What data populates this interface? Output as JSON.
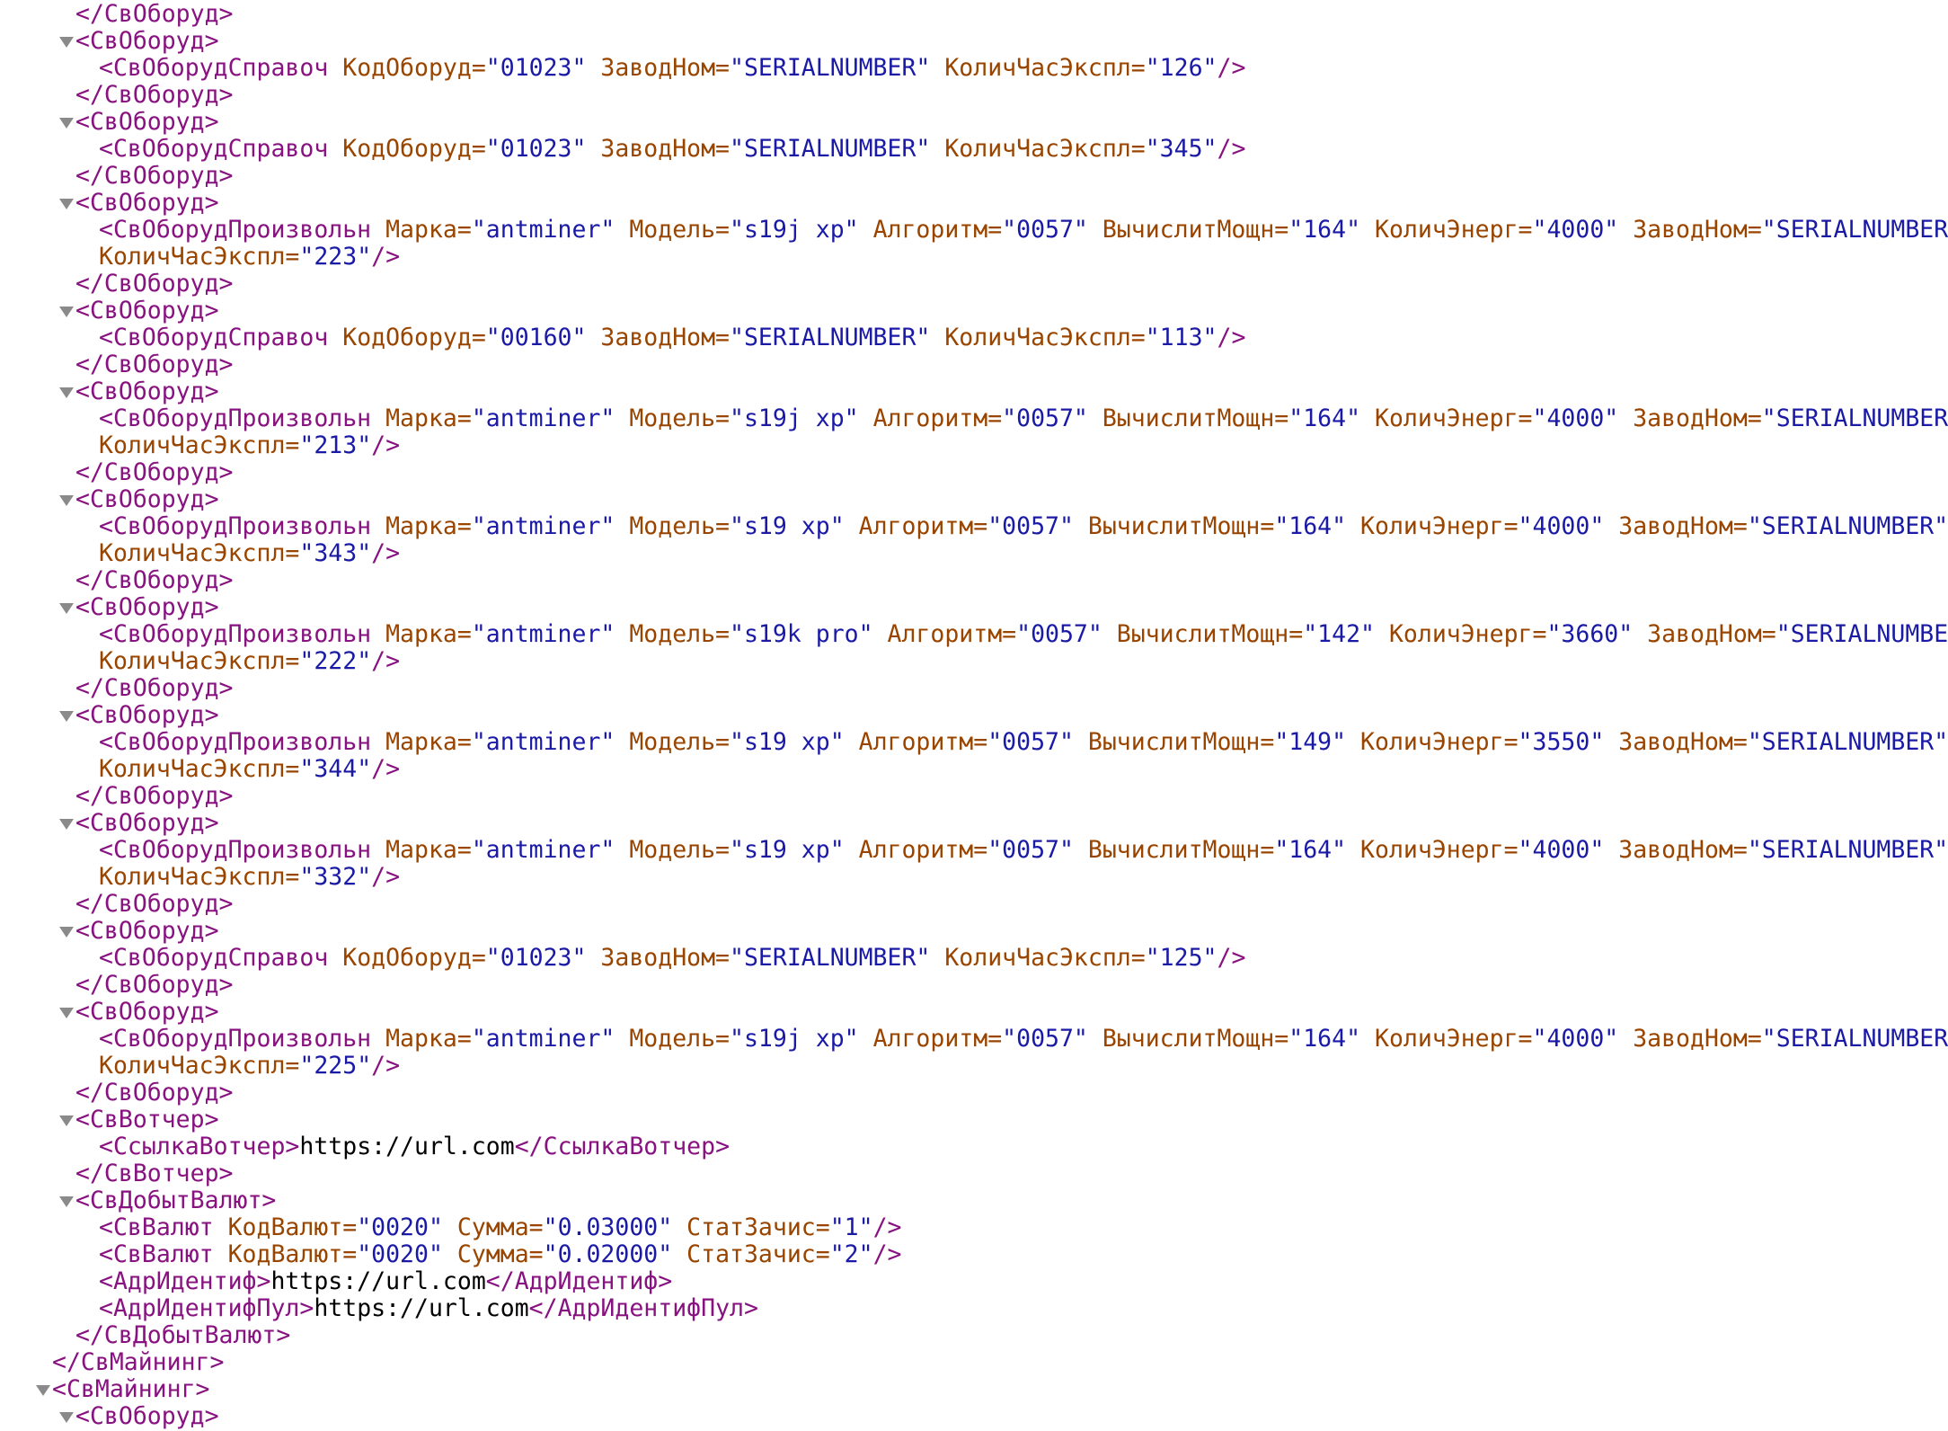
{
  "colors": {
    "tag": "#881280",
    "attribute_name": "#994500",
    "attribute_value": "#1a1aa6",
    "text": "#000000",
    "toggle": "#8a8a8a"
  },
  "lines": [
    {
      "indent": 1,
      "toggle": false,
      "segments": [
        {
          "t": "tag",
          "v": "</СвОборуд>"
        }
      ]
    },
    {
      "indent": 1,
      "toggle": true,
      "segments": [
        {
          "t": "tag",
          "v": "<СвОборуд>"
        }
      ]
    },
    {
      "indent": 2,
      "toggle": false,
      "segments": [
        {
          "t": "tag",
          "v": "<СвОборудСправоч "
        },
        {
          "t": "attr-name",
          "v": "КодОборуд="
        },
        {
          "t": "attr-value",
          "v": "\"01023\""
        },
        {
          "t": "attr-name",
          "v": " ЗаводНом="
        },
        {
          "t": "attr-value",
          "v": "\"SERIALNUMBER\""
        },
        {
          "t": "attr-name",
          "v": " КоличЧасЭкспл="
        },
        {
          "t": "attr-value",
          "v": "\"126\""
        },
        {
          "t": "tag",
          "v": "/>"
        }
      ]
    },
    {
      "indent": 1,
      "toggle": false,
      "segments": [
        {
          "t": "tag",
          "v": "</СвОборуд>"
        }
      ]
    },
    {
      "indent": 1,
      "toggle": true,
      "segments": [
        {
          "t": "tag",
          "v": "<СвОборуд>"
        }
      ]
    },
    {
      "indent": 2,
      "toggle": false,
      "segments": [
        {
          "t": "tag",
          "v": "<СвОборудСправоч "
        },
        {
          "t": "attr-name",
          "v": "КодОборуд="
        },
        {
          "t": "attr-value",
          "v": "\"01023\""
        },
        {
          "t": "attr-name",
          "v": " ЗаводНом="
        },
        {
          "t": "attr-value",
          "v": "\"SERIALNUMBER\""
        },
        {
          "t": "attr-name",
          "v": " КоличЧасЭкспл="
        },
        {
          "t": "attr-value",
          "v": "\"345\""
        },
        {
          "t": "tag",
          "v": "/>"
        }
      ]
    },
    {
      "indent": 1,
      "toggle": false,
      "segments": [
        {
          "t": "tag",
          "v": "</СвОборуд>"
        }
      ]
    },
    {
      "indent": 1,
      "toggle": true,
      "segments": [
        {
          "t": "tag",
          "v": "<СвОборуд>"
        }
      ]
    },
    {
      "indent": 2,
      "toggle": false,
      "segments": [
        {
          "t": "tag",
          "v": "<СвОборудПроизвольн "
        },
        {
          "t": "attr-name",
          "v": "Марка="
        },
        {
          "t": "attr-value",
          "v": "\"antminer\""
        },
        {
          "t": "attr-name",
          "v": " Модель="
        },
        {
          "t": "attr-value",
          "v": "\"s19j xp\""
        },
        {
          "t": "attr-name",
          "v": " Алгоритм="
        },
        {
          "t": "attr-value",
          "v": "\"0057\""
        },
        {
          "t": "attr-name",
          "v": " ВычислитМощн="
        },
        {
          "t": "attr-value",
          "v": "\"164\""
        },
        {
          "t": "attr-name",
          "v": " КоличЭнерг="
        },
        {
          "t": "attr-value",
          "v": "\"4000\""
        },
        {
          "t": "attr-name",
          "v": " ЗаводНом="
        },
        {
          "t": "attr-value",
          "v": "\"SERIALNUMBER\""
        }
      ]
    },
    {
      "indent": 2,
      "toggle": false,
      "segments": [
        {
          "t": "attr-name",
          "v": "КоличЧасЭкспл="
        },
        {
          "t": "attr-value",
          "v": "\"223\""
        },
        {
          "t": "tag",
          "v": "/>"
        }
      ]
    },
    {
      "indent": 1,
      "toggle": false,
      "segments": [
        {
          "t": "tag",
          "v": "</СвОборуд>"
        }
      ]
    },
    {
      "indent": 1,
      "toggle": true,
      "segments": [
        {
          "t": "tag",
          "v": "<СвОборуд>"
        }
      ]
    },
    {
      "indent": 2,
      "toggle": false,
      "segments": [
        {
          "t": "tag",
          "v": "<СвОборудСправоч "
        },
        {
          "t": "attr-name",
          "v": "КодОборуд="
        },
        {
          "t": "attr-value",
          "v": "\"00160\""
        },
        {
          "t": "attr-name",
          "v": " ЗаводНом="
        },
        {
          "t": "attr-value",
          "v": "\"SERIALNUMBER\""
        },
        {
          "t": "attr-name",
          "v": " КоличЧасЭкспл="
        },
        {
          "t": "attr-value",
          "v": "\"113\""
        },
        {
          "t": "tag",
          "v": "/>"
        }
      ]
    },
    {
      "indent": 1,
      "toggle": false,
      "segments": [
        {
          "t": "tag",
          "v": "</СвОборуд>"
        }
      ]
    },
    {
      "indent": 1,
      "toggle": true,
      "segments": [
        {
          "t": "tag",
          "v": "<СвОборуд>"
        }
      ]
    },
    {
      "indent": 2,
      "toggle": false,
      "segments": [
        {
          "t": "tag",
          "v": "<СвОборудПроизвольн "
        },
        {
          "t": "attr-name",
          "v": "Марка="
        },
        {
          "t": "attr-value",
          "v": "\"antminer\""
        },
        {
          "t": "attr-name",
          "v": " Модель="
        },
        {
          "t": "attr-value",
          "v": "\"s19j xp\""
        },
        {
          "t": "attr-name",
          "v": " Алгоритм="
        },
        {
          "t": "attr-value",
          "v": "\"0057\""
        },
        {
          "t": "attr-name",
          "v": " ВычислитМощн="
        },
        {
          "t": "attr-value",
          "v": "\"164\""
        },
        {
          "t": "attr-name",
          "v": " КоличЭнерг="
        },
        {
          "t": "attr-value",
          "v": "\"4000\""
        },
        {
          "t": "attr-name",
          "v": " ЗаводНом="
        },
        {
          "t": "attr-value",
          "v": "\"SERIALNUMBER\""
        }
      ]
    },
    {
      "indent": 2,
      "toggle": false,
      "segments": [
        {
          "t": "attr-name",
          "v": "КоличЧасЭкспл="
        },
        {
          "t": "attr-value",
          "v": "\"213\""
        },
        {
          "t": "tag",
          "v": "/>"
        }
      ]
    },
    {
      "indent": 1,
      "toggle": false,
      "segments": [
        {
          "t": "tag",
          "v": "</СвОборуд>"
        }
      ]
    },
    {
      "indent": 1,
      "toggle": true,
      "segments": [
        {
          "t": "tag",
          "v": "<СвОборуд>"
        }
      ]
    },
    {
      "indent": 2,
      "toggle": false,
      "segments": [
        {
          "t": "tag",
          "v": "<СвОборудПроизвольн "
        },
        {
          "t": "attr-name",
          "v": "Марка="
        },
        {
          "t": "attr-value",
          "v": "\"antminer\""
        },
        {
          "t": "attr-name",
          "v": " Модель="
        },
        {
          "t": "attr-value",
          "v": "\"s19 xp\""
        },
        {
          "t": "attr-name",
          "v": " Алгоритм="
        },
        {
          "t": "attr-value",
          "v": "\"0057\""
        },
        {
          "t": "attr-name",
          "v": " ВычислитМощн="
        },
        {
          "t": "attr-value",
          "v": "\"164\""
        },
        {
          "t": "attr-name",
          "v": " КоличЭнерг="
        },
        {
          "t": "attr-value",
          "v": "\"4000\""
        },
        {
          "t": "attr-name",
          "v": " ЗаводНом="
        },
        {
          "t": "attr-value",
          "v": "\"SERIALNUMBER\""
        }
      ]
    },
    {
      "indent": 2,
      "toggle": false,
      "segments": [
        {
          "t": "attr-name",
          "v": "КоличЧасЭкспл="
        },
        {
          "t": "attr-value",
          "v": "\"343\""
        },
        {
          "t": "tag",
          "v": "/>"
        }
      ]
    },
    {
      "indent": 1,
      "toggle": false,
      "segments": [
        {
          "t": "tag",
          "v": "</СвОборуд>"
        }
      ]
    },
    {
      "indent": 1,
      "toggle": true,
      "segments": [
        {
          "t": "tag",
          "v": "<СвОборуд>"
        }
      ]
    },
    {
      "indent": 2,
      "toggle": false,
      "segments": [
        {
          "t": "tag",
          "v": "<СвОборудПроизвольн "
        },
        {
          "t": "attr-name",
          "v": "Марка="
        },
        {
          "t": "attr-value",
          "v": "\"antminer\""
        },
        {
          "t": "attr-name",
          "v": " Модель="
        },
        {
          "t": "attr-value",
          "v": "\"s19k pro\""
        },
        {
          "t": "attr-name",
          "v": " Алгоритм="
        },
        {
          "t": "attr-value",
          "v": "\"0057\""
        },
        {
          "t": "attr-name",
          "v": " ВычислитМощн="
        },
        {
          "t": "attr-value",
          "v": "\"142\""
        },
        {
          "t": "attr-name",
          "v": " КоличЭнерг="
        },
        {
          "t": "attr-value",
          "v": "\"3660\""
        },
        {
          "t": "attr-name",
          "v": " ЗаводНом="
        },
        {
          "t": "attr-value",
          "v": "\"SERIALNUMBER\""
        }
      ]
    },
    {
      "indent": 2,
      "toggle": false,
      "segments": [
        {
          "t": "attr-name",
          "v": "КоличЧасЭкспл="
        },
        {
          "t": "attr-value",
          "v": "\"222\""
        },
        {
          "t": "tag",
          "v": "/>"
        }
      ]
    },
    {
      "indent": 1,
      "toggle": false,
      "segments": [
        {
          "t": "tag",
          "v": "</СвОборуд>"
        }
      ]
    },
    {
      "indent": 1,
      "toggle": true,
      "segments": [
        {
          "t": "tag",
          "v": "<СвОборуд>"
        }
      ]
    },
    {
      "indent": 2,
      "toggle": false,
      "segments": [
        {
          "t": "tag",
          "v": "<СвОборудПроизвольн "
        },
        {
          "t": "attr-name",
          "v": "Марка="
        },
        {
          "t": "attr-value",
          "v": "\"antminer\""
        },
        {
          "t": "attr-name",
          "v": " Модель="
        },
        {
          "t": "attr-value",
          "v": "\"s19 xp\""
        },
        {
          "t": "attr-name",
          "v": " Алгоритм="
        },
        {
          "t": "attr-value",
          "v": "\"0057\""
        },
        {
          "t": "attr-name",
          "v": " ВычислитМощн="
        },
        {
          "t": "attr-value",
          "v": "\"149\""
        },
        {
          "t": "attr-name",
          "v": " КоличЭнерг="
        },
        {
          "t": "attr-value",
          "v": "\"3550\""
        },
        {
          "t": "attr-name",
          "v": " ЗаводНом="
        },
        {
          "t": "attr-value",
          "v": "\"SERIALNUMBER\""
        }
      ]
    },
    {
      "indent": 2,
      "toggle": false,
      "segments": [
        {
          "t": "attr-name",
          "v": "КоличЧасЭкспл="
        },
        {
          "t": "attr-value",
          "v": "\"344\""
        },
        {
          "t": "tag",
          "v": "/>"
        }
      ]
    },
    {
      "indent": 1,
      "toggle": false,
      "segments": [
        {
          "t": "tag",
          "v": "</СвОборуд>"
        }
      ]
    },
    {
      "indent": 1,
      "toggle": true,
      "segments": [
        {
          "t": "tag",
          "v": "<СвОборуд>"
        }
      ]
    },
    {
      "indent": 2,
      "toggle": false,
      "segments": [
        {
          "t": "tag",
          "v": "<СвОборудПроизвольн "
        },
        {
          "t": "attr-name",
          "v": "Марка="
        },
        {
          "t": "attr-value",
          "v": "\"antminer\""
        },
        {
          "t": "attr-name",
          "v": " Модель="
        },
        {
          "t": "attr-value",
          "v": "\"s19 xp\""
        },
        {
          "t": "attr-name",
          "v": " Алгоритм="
        },
        {
          "t": "attr-value",
          "v": "\"0057\""
        },
        {
          "t": "attr-name",
          "v": " ВычислитМощн="
        },
        {
          "t": "attr-value",
          "v": "\"164\""
        },
        {
          "t": "attr-name",
          "v": " КоличЭнерг="
        },
        {
          "t": "attr-value",
          "v": "\"4000\""
        },
        {
          "t": "attr-name",
          "v": " ЗаводНом="
        },
        {
          "t": "attr-value",
          "v": "\"SERIALNUMBER\""
        }
      ]
    },
    {
      "indent": 2,
      "toggle": false,
      "segments": [
        {
          "t": "attr-name",
          "v": "КоличЧасЭкспл="
        },
        {
          "t": "attr-value",
          "v": "\"332\""
        },
        {
          "t": "tag",
          "v": "/>"
        }
      ]
    },
    {
      "indent": 1,
      "toggle": false,
      "segments": [
        {
          "t": "tag",
          "v": "</СвОборуд>"
        }
      ]
    },
    {
      "indent": 1,
      "toggle": true,
      "segments": [
        {
          "t": "tag",
          "v": "<СвОборуд>"
        }
      ]
    },
    {
      "indent": 2,
      "toggle": false,
      "segments": [
        {
          "t": "tag",
          "v": "<СвОборудСправоч "
        },
        {
          "t": "attr-name",
          "v": "КодОборуд="
        },
        {
          "t": "attr-value",
          "v": "\"01023\""
        },
        {
          "t": "attr-name",
          "v": " ЗаводНом="
        },
        {
          "t": "attr-value",
          "v": "\"SERIALNUMBER\""
        },
        {
          "t": "attr-name",
          "v": " КоличЧасЭкспл="
        },
        {
          "t": "attr-value",
          "v": "\"125\""
        },
        {
          "t": "tag",
          "v": "/>"
        }
      ]
    },
    {
      "indent": 1,
      "toggle": false,
      "segments": [
        {
          "t": "tag",
          "v": "</СвОборуд>"
        }
      ]
    },
    {
      "indent": 1,
      "toggle": true,
      "segments": [
        {
          "t": "tag",
          "v": "<СвОборуд>"
        }
      ]
    },
    {
      "indent": 2,
      "toggle": false,
      "segments": [
        {
          "t": "tag",
          "v": "<СвОборудПроизвольн "
        },
        {
          "t": "attr-name",
          "v": "Марка="
        },
        {
          "t": "attr-value",
          "v": "\"antminer\""
        },
        {
          "t": "attr-name",
          "v": " Модель="
        },
        {
          "t": "attr-value",
          "v": "\"s19j xp\""
        },
        {
          "t": "attr-name",
          "v": " Алгоритм="
        },
        {
          "t": "attr-value",
          "v": "\"0057\""
        },
        {
          "t": "attr-name",
          "v": " ВычислитМощн="
        },
        {
          "t": "attr-value",
          "v": "\"164\""
        },
        {
          "t": "attr-name",
          "v": " КоличЭнерг="
        },
        {
          "t": "attr-value",
          "v": "\"4000\""
        },
        {
          "t": "attr-name",
          "v": " ЗаводНом="
        },
        {
          "t": "attr-value",
          "v": "\"SERIALNUMBER\""
        }
      ]
    },
    {
      "indent": 2,
      "toggle": false,
      "segments": [
        {
          "t": "attr-name",
          "v": "КоличЧасЭкспл="
        },
        {
          "t": "attr-value",
          "v": "\"225\""
        },
        {
          "t": "tag",
          "v": "/>"
        }
      ]
    },
    {
      "indent": 1,
      "toggle": false,
      "segments": [
        {
          "t": "tag",
          "v": "</СвОборуд>"
        }
      ]
    },
    {
      "indent": 1,
      "toggle": true,
      "segments": [
        {
          "t": "tag",
          "v": "<СвВотчер>"
        }
      ]
    },
    {
      "indent": 2,
      "toggle": false,
      "segments": [
        {
          "t": "tag",
          "v": "<СсылкаВотчер>"
        },
        {
          "t": "text",
          "v": "https://url.com"
        },
        {
          "t": "tag",
          "v": "</СсылкаВотчер>"
        }
      ]
    },
    {
      "indent": 1,
      "toggle": false,
      "segments": [
        {
          "t": "tag",
          "v": "</СвВотчер>"
        }
      ]
    },
    {
      "indent": 1,
      "toggle": true,
      "segments": [
        {
          "t": "tag",
          "v": "<СвДобытВалют>"
        }
      ]
    },
    {
      "indent": 2,
      "toggle": false,
      "segments": [
        {
          "t": "tag",
          "v": "<СвВалют "
        },
        {
          "t": "attr-name",
          "v": "КодВалют="
        },
        {
          "t": "attr-value",
          "v": "\"0020\""
        },
        {
          "t": "attr-name",
          "v": " Сумма="
        },
        {
          "t": "attr-value",
          "v": "\"0.03000\""
        },
        {
          "t": "attr-name",
          "v": " СтатЗачис="
        },
        {
          "t": "attr-value",
          "v": "\"1\""
        },
        {
          "t": "tag",
          "v": "/>"
        }
      ]
    },
    {
      "indent": 2,
      "toggle": false,
      "segments": [
        {
          "t": "tag",
          "v": "<СвВалют "
        },
        {
          "t": "attr-name",
          "v": "КодВалют="
        },
        {
          "t": "attr-value",
          "v": "\"0020\""
        },
        {
          "t": "attr-name",
          "v": " Сумма="
        },
        {
          "t": "attr-value",
          "v": "\"0.02000\""
        },
        {
          "t": "attr-name",
          "v": " СтатЗачис="
        },
        {
          "t": "attr-value",
          "v": "\"2\""
        },
        {
          "t": "tag",
          "v": "/>"
        }
      ]
    },
    {
      "indent": 2,
      "toggle": false,
      "segments": [
        {
          "t": "tag",
          "v": "<АдрИдентиф>"
        },
        {
          "t": "text",
          "v": "https://url.com"
        },
        {
          "t": "tag",
          "v": "</АдрИдентиф>"
        }
      ]
    },
    {
      "indent": 2,
      "toggle": false,
      "segments": [
        {
          "t": "tag",
          "v": "<АдрИдентифПул>"
        },
        {
          "t": "text",
          "v": "https://url.com"
        },
        {
          "t": "tag",
          "v": "</АдрИдентифПул>"
        }
      ]
    },
    {
      "indent": 1,
      "toggle": false,
      "segments": [
        {
          "t": "tag",
          "v": "</СвДобытВалют>"
        }
      ]
    },
    {
      "indent": 0,
      "toggle": false,
      "segments": [
        {
          "t": "tag",
          "v": "</СвМайнинг>"
        }
      ]
    },
    {
      "indent": 0,
      "toggle": true,
      "segments": [
        {
          "t": "tag",
          "v": "<СвМайнинг>"
        }
      ]
    },
    {
      "indent": 1,
      "toggle": true,
      "segments": [
        {
          "t": "tag",
          "v": "<СвОборуд>"
        }
      ]
    }
  ]
}
